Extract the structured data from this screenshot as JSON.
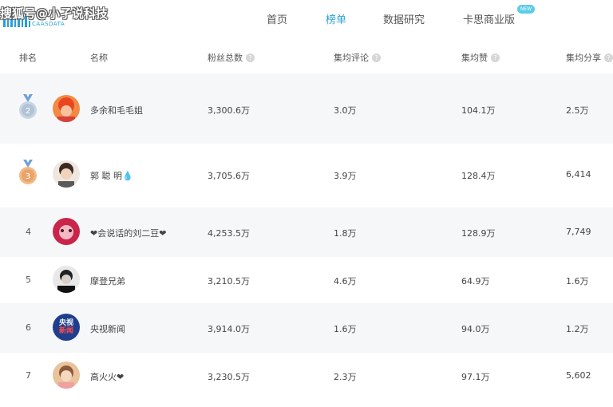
{
  "header": {
    "watermark": "搜狐号@小孑说科技",
    "logo_sub": "CAASDATA",
    "nav": [
      {
        "label": "首页",
        "active": false
      },
      {
        "label": "榜单",
        "active": true
      },
      {
        "label": "数据研究",
        "active": false
      },
      {
        "label": "卡思商业版",
        "active": false
      }
    ],
    "badge": "NEW"
  },
  "columns": [
    "排名",
    "名称",
    "粉丝总数",
    "集均评论",
    "集均赞",
    "集均分享"
  ],
  "help_glyph": "?",
  "rows": [
    {
      "rank": "2",
      "name": "多余和毛毛姐",
      "fans": "3,300.6万",
      "comments": "3.0万",
      "likes": "104.1万",
      "shares": "2.5万",
      "medal": "silver"
    },
    {
      "rank": "3",
      "name": "郭 聪 明💧",
      "fans": "3,705.6万",
      "comments": "3.9万",
      "likes": "128.4万",
      "shares": "6,414",
      "medal": "bronze"
    },
    {
      "rank": "4",
      "name": "❤会说话的刘二豆❤",
      "fans": "4,253.5万",
      "comments": "1.8万",
      "likes": "128.9万",
      "shares": "7,749"
    },
    {
      "rank": "5",
      "name": "摩登兄弟",
      "fans": "3,210.5万",
      "comments": "4.6万",
      "likes": "64.9万",
      "shares": "1.6万"
    },
    {
      "rank": "6",
      "name": "央视新闻",
      "fans": "3,914.0万",
      "comments": "1.6万",
      "likes": "94.0万",
      "shares": "1.2万",
      "avatar_text": [
        "央视",
        "新闻"
      ]
    },
    {
      "rank": "7",
      "name": "高火火❤",
      "fans": "3,230.5万",
      "comments": "2.3万",
      "likes": "97.1万",
      "shares": "5,602"
    }
  ],
  "colors": {
    "accent": "#29a3d9",
    "silver": "#b8c7d6",
    "bronze": "#e9a46a",
    "row_shade": "#f6f7f9"
  }
}
